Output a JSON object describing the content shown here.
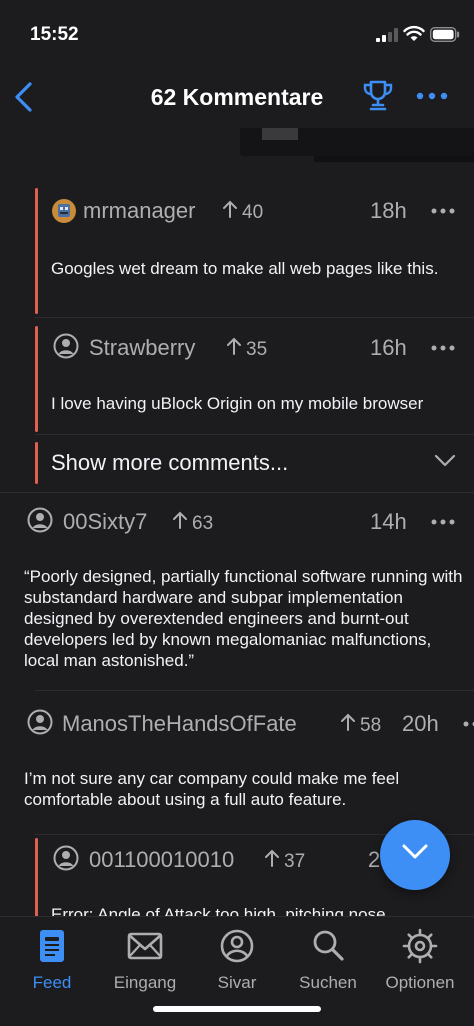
{
  "status_bar": {
    "time": "15:52"
  },
  "nav": {
    "title": "62 Kommentare"
  },
  "comments": [
    {
      "user": "mrmanager",
      "score": "40",
      "age": "18h",
      "text": "Googles wet dream to make all web pages like this."
    },
    {
      "user": "Strawberry",
      "score": "35",
      "age": "16h",
      "text": "I love having uBlock Origin on my mobile browser"
    },
    {
      "user": "00Sixty7",
      "score": "63",
      "age": "14h",
      "text": "“Poorly designed, partially functional software running with substandard hardware and subpar implementation designed by overextended engineers and burnt-out developers led by known megalomaniac malfunctions, local man astonished.”"
    },
    {
      "user": "ManosTheHandsOfFate",
      "score": "58",
      "age": "20h",
      "text": "I’m not sure any car company could make me feel comfortable about using a full auto feature."
    },
    {
      "user": "001100010010",
      "score": "37",
      "age": "2",
      "text": "Error: Angle of Attack too high, pitching nose"
    }
  ],
  "show_more": {
    "label": "Show more comments..."
  },
  "tabs": [
    {
      "label": "Feed",
      "icon": "feed-icon",
      "active": true
    },
    {
      "label": "Eingang",
      "icon": "envelope-icon",
      "active": false
    },
    {
      "label": "Sivar",
      "icon": "user-icon",
      "active": false
    },
    {
      "label": "Suchen",
      "icon": "search-icon",
      "active": false
    },
    {
      "label": "Optionen",
      "icon": "gear-icon",
      "active": false
    }
  ],
  "colors": {
    "accent": "#3d8ef5",
    "thread_bar": "#e0614f",
    "background": "#1c1c1e"
  }
}
